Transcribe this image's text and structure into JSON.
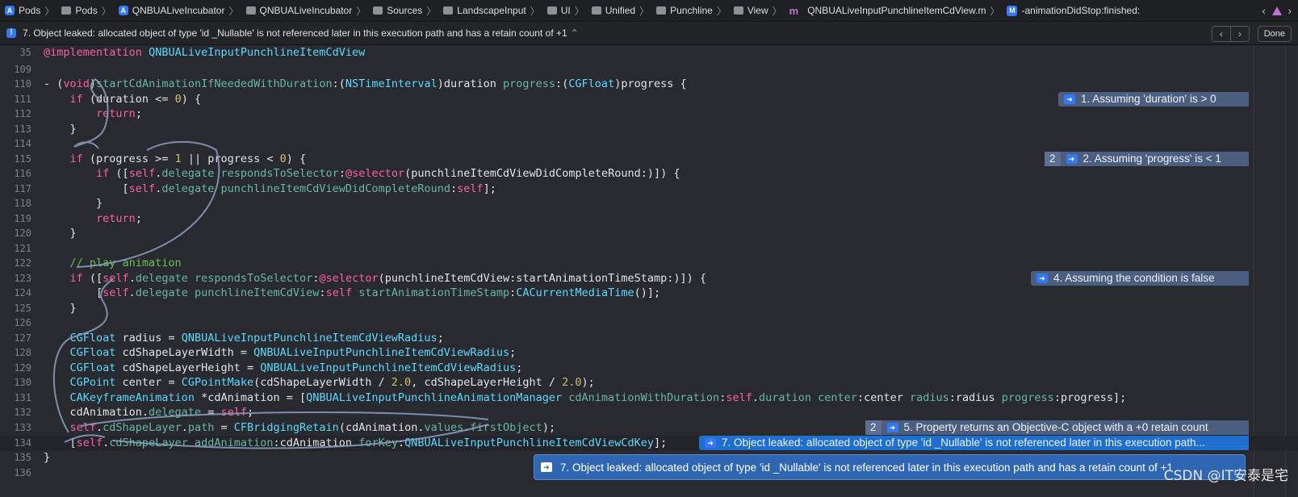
{
  "breadcrumbs": [
    "Pods",
    "Pods",
    "QNBUALiveIncubator",
    "QNBUALiveIncubator",
    "Sources",
    "LandscapeInput",
    "UI",
    "Unified",
    "Punchline",
    "View",
    "QNBUALiveInputPunchlineItemCdView.m",
    "-animationDidStop:finished:"
  ],
  "issue": {
    "text": "7. Object leaked: allocated object of type 'id _Nullable' is not referenced later in this execution path and has a retain count of +1",
    "stepper": "⌃",
    "done_label": "Done"
  },
  "line_numbers": [
    "35",
    "109",
    "110",
    "111",
    "112",
    "113",
    "114",
    "115",
    "116",
    "117",
    "118",
    "119",
    "120",
    "121",
    "122",
    "123",
    "124",
    "125",
    "126",
    "127",
    "128",
    "129",
    "130",
    "131",
    "132",
    "133",
    "134",
    "135",
    "136"
  ],
  "annotations": [
    {
      "num": "",
      "text": "1. Assuming 'duration' is > 0"
    },
    {
      "num": "2",
      "text": "2. Assuming 'progress' is < 1"
    },
    {
      "num": "",
      "text": "4. Assuming the condition is false"
    },
    {
      "num": "2",
      "text": "5. Property returns an Objective-C object with a +0 retain count"
    },
    {
      "num": "",
      "text": "7. Object leaked: allocated object of type 'id _Nullable' is not referenced later in this execution path..."
    }
  ],
  "tooltip": {
    "text": "7. Object leaked: allocated object of type 'id _Nullable' is not referenced later in this execution path and has a retain count of +1"
  },
  "watermark": "CSDN @IT安泰是宅",
  "colors": {
    "keyword": "#fc5fa3",
    "type": "#5dd8ff",
    "number": "#d0bf69",
    "comment": "#6bbf59",
    "accent": "#3478f6"
  }
}
